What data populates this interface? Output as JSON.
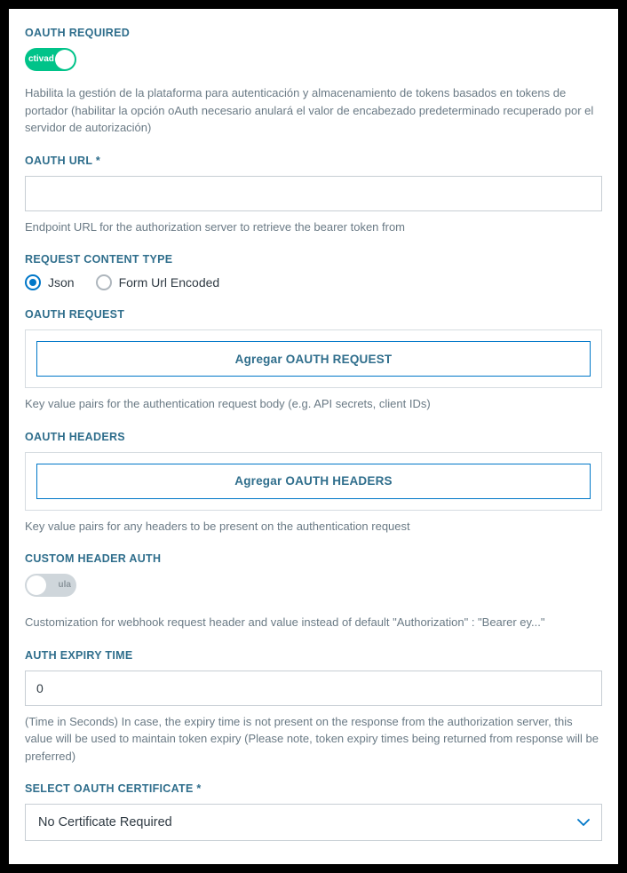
{
  "oauth_required": {
    "label": "OAUTH REQUIRED",
    "toggle_text": "ctivad",
    "help": "Habilita la gestión de la plataforma para autenticación y almacenamiento de tokens basados en tokens de portador (habilitar la opción oAuth necesario anulará el valor de encabezado predeterminado recuperado por el servidor de autorización)"
  },
  "oauth_url": {
    "label": "OAUTH URL *",
    "value": "",
    "help": "Endpoint URL for the authorization server to retrieve the bearer token from"
  },
  "request_content_type": {
    "label": "REQUEST CONTENT TYPE",
    "options": {
      "json": "Json",
      "form": "Form Url Encoded"
    },
    "selected": "json"
  },
  "oauth_request": {
    "label": "OAUTH REQUEST",
    "button": "Agregar OAUTH REQUEST",
    "help": "Key value pairs for the authentication request body (e.g. API secrets, client IDs)"
  },
  "oauth_headers": {
    "label": "OAUTH HEADERS",
    "button": "Agregar OAUTH HEADERS",
    "help": "Key value pairs for any headers to be present on the authentication request"
  },
  "custom_header_auth": {
    "label": "CUSTOM HEADER AUTH",
    "toggle_text": "ula",
    "help": "Customization for webhook request header and value instead of default \"Authorization\" : \"Bearer ey...\""
  },
  "auth_expiry": {
    "label": "AUTH EXPIRY TIME",
    "value": "0",
    "help": "(Time in Seconds) In case, the expiry time is not present on the response from the authorization server, this value will be used to maintain token expiry (Please note, token expiry times being returned from response will be preferred)"
  },
  "oauth_cert": {
    "label": "SELECT OAUTH CERTIFICATE *",
    "selected": "No Certificate Required"
  }
}
